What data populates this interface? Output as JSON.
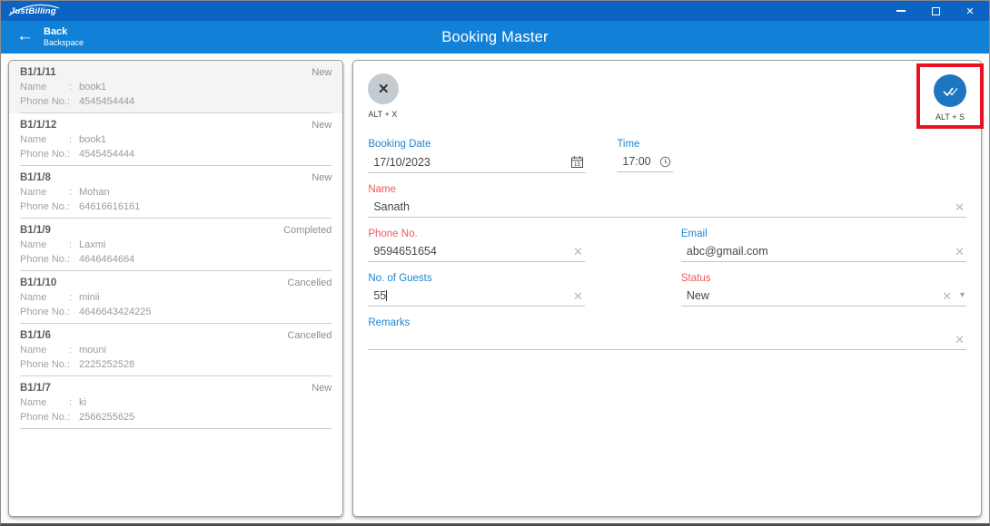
{
  "titlebar": {
    "app_name": "JustBilling",
    "minimize_glyph": "–",
    "close_glyph": "✕"
  },
  "header": {
    "back_arrow": "←",
    "back": "Back",
    "back_shortcut": "Backspace",
    "title": "Booking Master"
  },
  "booking_list": {
    "name_label": "Name",
    "name_colon": ":",
    "phone_label": "Phone No.:",
    "items": [
      {
        "id": "B1/1/11",
        "status": "New",
        "name": "book1",
        "phone": "4545454444"
      },
      {
        "id": "B1/1/12",
        "status": "New",
        "name": "book1",
        "phone": "4545454444"
      },
      {
        "id": "B1/1/8",
        "status": "New",
        "name": "Mohan",
        "phone": "64616616161"
      },
      {
        "id": "B1/1/9",
        "status": "Completed",
        "name": "Laxmi",
        "phone": "4646464664"
      },
      {
        "id": "B1/1/10",
        "status": "Cancelled",
        "name": "minii",
        "phone": "4646643424225"
      },
      {
        "id": "B1/1/6",
        "status": "Cancelled",
        "name": "mouni",
        "phone": "2225252528"
      },
      {
        "id": "B1/1/7",
        "status": "New",
        "name": "ki",
        "phone": "2566255625"
      }
    ]
  },
  "form": {
    "cancel": {
      "icon_glyph": "✕",
      "shortcut": "ALT + X"
    },
    "save": {
      "shortcut": "ALT + S"
    },
    "clear_glyph": "✕",
    "dropdown_glyph": "▾",
    "booking_date": {
      "label": "Booking Date",
      "value": "17/10/2023",
      "calendar_day": "15"
    },
    "time": {
      "label": "Time",
      "value": "17:00"
    },
    "name": {
      "label": "Name",
      "value": "Sanath"
    },
    "phone": {
      "label": "Phone No.",
      "value": "9594651654"
    },
    "email": {
      "label": "Email",
      "value": "abc@gmail.com"
    },
    "guests": {
      "label": "No. of Guests",
      "value": "55"
    },
    "status": {
      "label": "Status",
      "value": "New"
    },
    "remarks": {
      "label": "Remarks",
      "value": ""
    }
  },
  "colors": {
    "titlebar_blue": "#0b64c4",
    "header_blue": "#1181d8",
    "label_blue": "#1f87d3",
    "label_red": "#eb5a5e",
    "save_button_blue": "#1d76c0",
    "annotation_red": "#e81123"
  }
}
